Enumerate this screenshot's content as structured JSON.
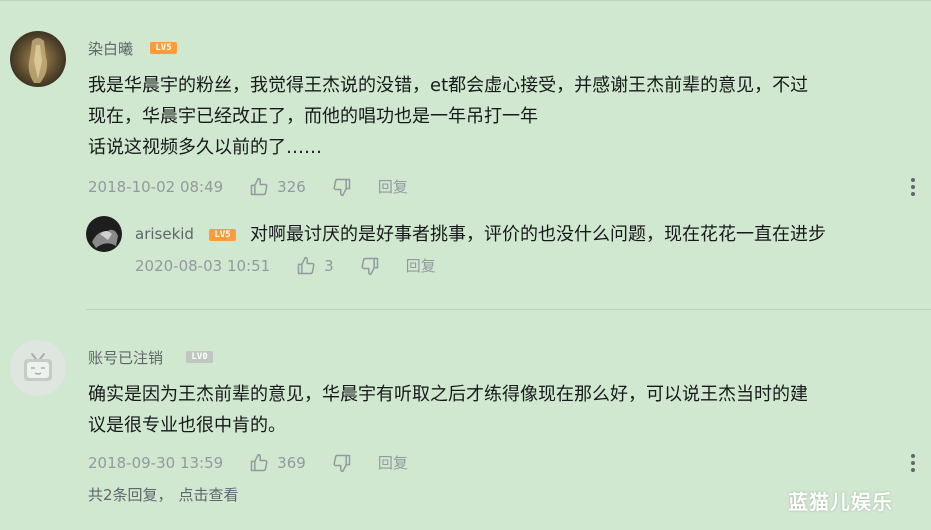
{
  "colors": {
    "background": "#cfe8cf",
    "level5": "#ff9b3a",
    "level0": "#bfc7bf",
    "meta_text": "#9499a0"
  },
  "comments": [
    {
      "username": "染白曦",
      "level": "LV5",
      "content_lines": [
        "我是华晨宇的粉丝，我觉得王杰说的没错，et都会虚心接受，并感谢王杰前辈的意见，不过",
        "现在，华晨宇已经改正了，而他的唱功也是一年吊打一年",
        "话说这视频多久以前的了……"
      ],
      "time": "2018-10-02 08:49",
      "likes": "326",
      "reply_label": "回复",
      "replies": [
        {
          "username": "arisekid",
          "level": "LV5",
          "content": "对啊最讨厌的是好事者挑事，评价的也没什么问题，现在花花一直在进步",
          "time": "2020-08-03 10:51",
          "likes": "3",
          "reply_label": "回复"
        }
      ]
    },
    {
      "username": "账号已注销",
      "level": "LV0",
      "content_lines": [
        "确实是因为王杰前辈的意见，华晨宇有听取之后才练得像现在那么好，可以说王杰当时的建",
        "议是很专业也很中肯的。"
      ],
      "time": "2018-09-30 13:59",
      "likes": "369",
      "reply_label": "回复",
      "replies_summary": "共2条回复，",
      "view_label": "点击查看"
    }
  ],
  "watermark": "蓝猫儿娱乐",
  "icons": [
    "thumbs-up-icon",
    "thumbs-down-icon",
    "more-vertical-icon",
    "tv-mascot-icon"
  ]
}
